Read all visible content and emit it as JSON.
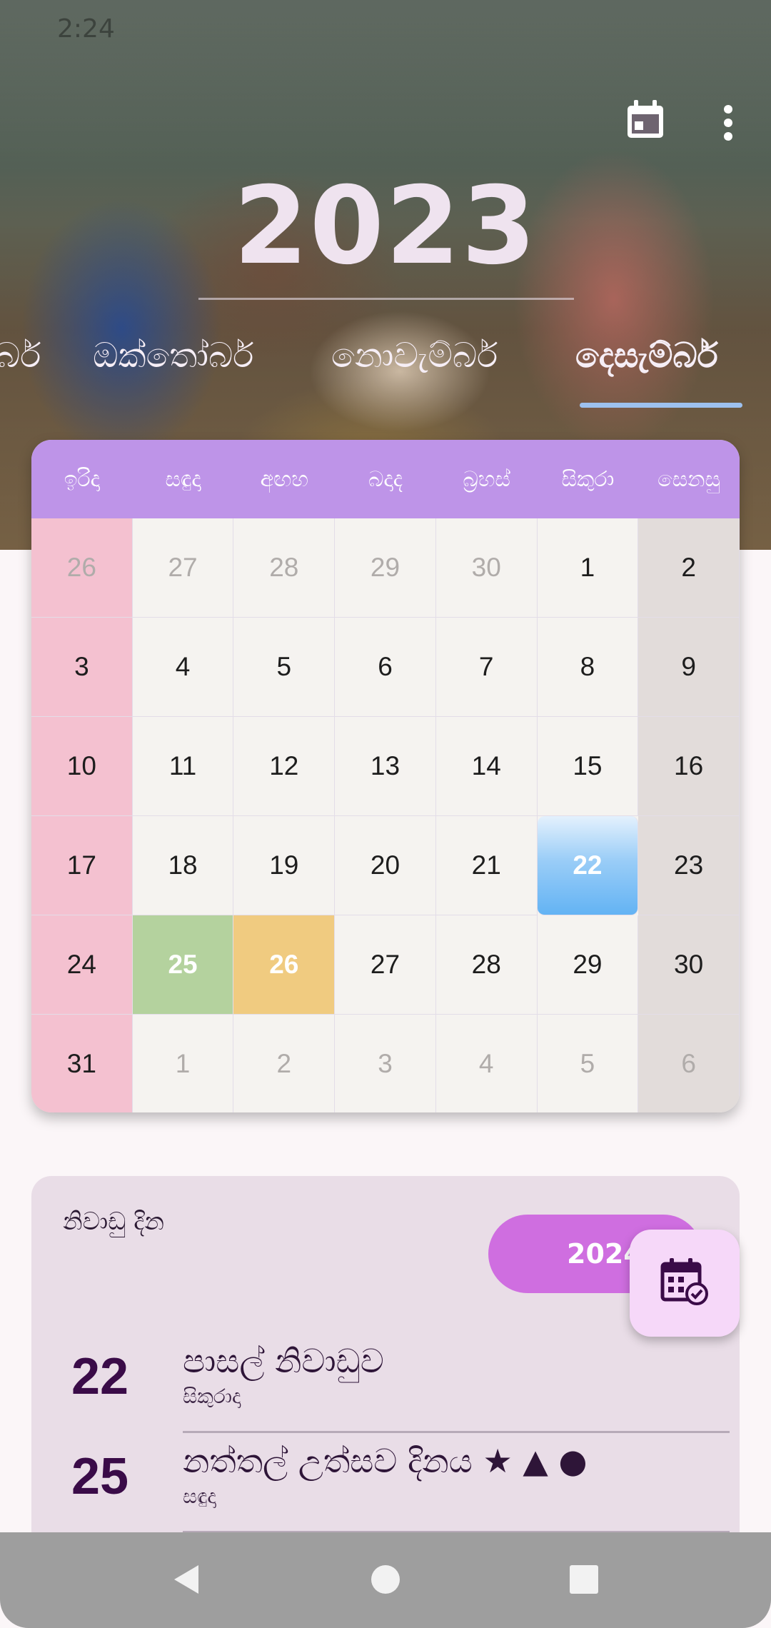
{
  "status_bar": {
    "time": "2:24"
  },
  "header": {
    "year": "2023",
    "months": [
      "බර්",
      "ඔක්තෝබර්",
      "නොවැම්බර්",
      "දෙසැම්බර්"
    ],
    "active_month_index": 3,
    "icons": {
      "calendar": "calendar-icon",
      "more": "more-vertical-icon"
    }
  },
  "calendar": {
    "weekdays": [
      "ඉරිදා",
      "සඳුදා",
      "අඟහ",
      "බදාද",
      "බ්‍රහස්",
      "සිකුරා",
      "සෙනසු"
    ],
    "weeks": [
      [
        "26",
        "27",
        "28",
        "29",
        "30",
        "1",
        "2"
      ],
      [
        "3",
        "4",
        "5",
        "6",
        "7",
        "8",
        "9"
      ],
      [
        "10",
        "11",
        "12",
        "13",
        "14",
        "15",
        "16"
      ],
      [
        "17",
        "18",
        "19",
        "20",
        "21",
        "22",
        "23"
      ],
      [
        "24",
        "25",
        "26",
        "27",
        "28",
        "29",
        "30"
      ],
      [
        "31",
        "1",
        "2",
        "3",
        "4",
        "5",
        "6"
      ]
    ],
    "today": "22",
    "holiday_green": "25",
    "holiday_yellow": "26",
    "colors": {
      "header": "#be94e8",
      "sunday": "#f4c1d0",
      "saturday": "#e2dcda",
      "today": "#63b3f4",
      "holiday_green": "#b4d29e",
      "holiday_yellow": "#f0cb80"
    }
  },
  "holidays": {
    "title": "නිවාඩු දින",
    "year_button": "2024",
    "fab_icon": "calendar-check-icon",
    "items": [
      {
        "day": "22",
        "name": "පාසල් නිවාඩුව",
        "weekday": "සිකුරාදා"
      },
      {
        "day": "25",
        "name": "නත්තල් උත්සව දිනය ★ ▲ ●",
        "weekday": "සඳුදා"
      }
    ]
  },
  "navigation": {
    "back": "back-icon",
    "home": "home-icon",
    "recents": "recents-icon"
  }
}
